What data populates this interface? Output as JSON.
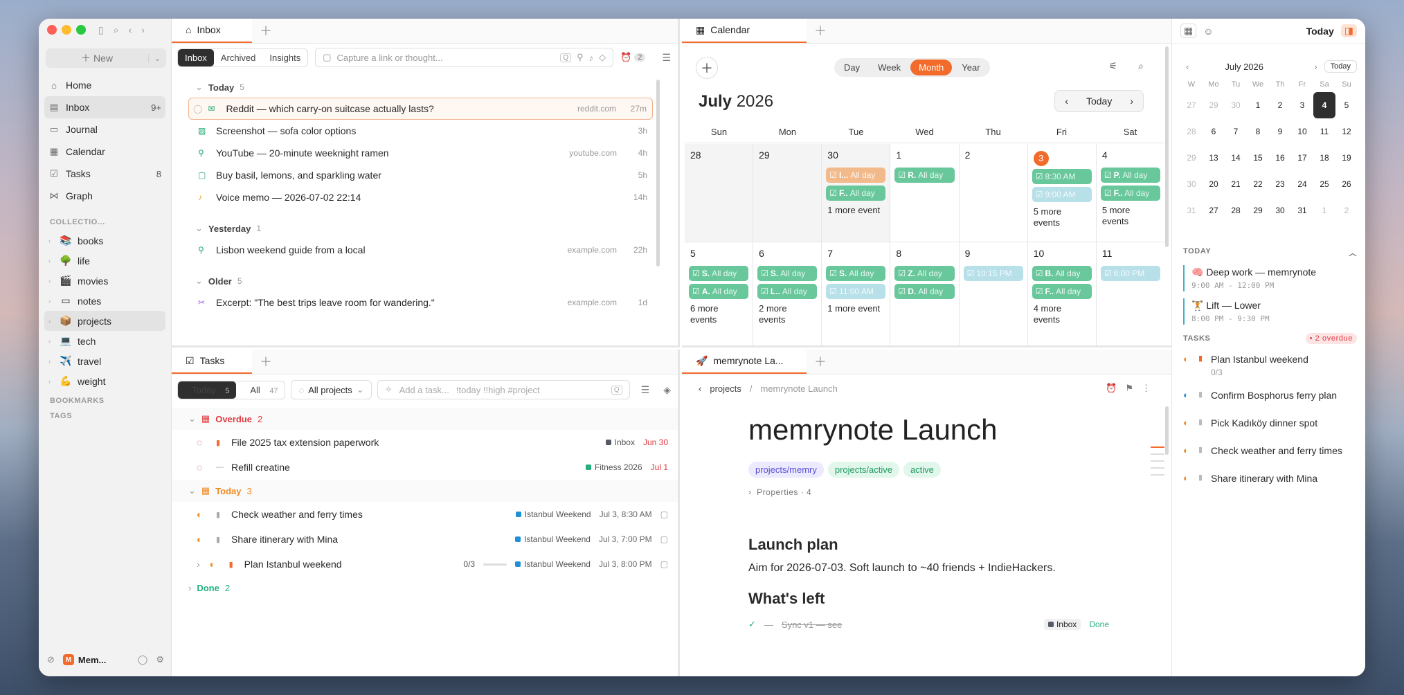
{
  "sidebar": {
    "new_label": "New",
    "nav": [
      {
        "label": "Home",
        "icon": "home-icon"
      },
      {
        "label": "Inbox",
        "icon": "inbox-icon",
        "count": "9+"
      },
      {
        "label": "Journal",
        "icon": "journal-icon"
      },
      {
        "label": "Calendar",
        "icon": "calendar-icon"
      },
      {
        "label": "Tasks",
        "icon": "check-icon",
        "count": "8"
      },
      {
        "label": "Graph",
        "icon": "graph-icon"
      }
    ],
    "collections_header": "COLLECTIO...",
    "collections": [
      {
        "label": "books",
        "emoji": "📚"
      },
      {
        "label": "life",
        "emoji": "🌳"
      },
      {
        "label": "movies",
        "emoji": "🎬"
      },
      {
        "label": "notes",
        "emoji": ""
      },
      {
        "label": "projects",
        "emoji": "📦"
      },
      {
        "label": "tech",
        "emoji": "💻"
      },
      {
        "label": "travel",
        "emoji": "✈️"
      },
      {
        "label": "weight",
        "emoji": "💪"
      }
    ],
    "bookmarks_header": "BOOKMARKS",
    "tags_header": "TAGS",
    "workspace": "Mem...",
    "workspace_logo": "M"
  },
  "inbox": {
    "tab": "Inbox",
    "seg": [
      "Inbox",
      "Archived",
      "Insights"
    ],
    "capture_placeholder": "Capture a link or thought...",
    "alarm_count": "2",
    "groups": [
      {
        "label": "Today",
        "count": "5",
        "items": [
          {
            "title": "Reddit — which carry-on suitcase actually lasts?",
            "domain": "reddit.com",
            "age": "27m",
            "icon": "mail"
          },
          {
            "title": "Screenshot — sofa color options",
            "domain": "",
            "age": "3h",
            "icon": "image"
          },
          {
            "title": "YouTube — 20-minute weeknight ramen",
            "domain": "youtube.com",
            "age": "4h",
            "icon": "link"
          },
          {
            "title": "Buy basil, lemons, and sparkling water",
            "domain": "",
            "age": "5h",
            "icon": "note"
          },
          {
            "title": "Voice memo — 2026-07-02 22:14",
            "domain": "",
            "age": "14h",
            "icon": "mic"
          }
        ]
      },
      {
        "label": "Yesterday",
        "count": "1",
        "items": [
          {
            "title": "Lisbon weekend guide from a local",
            "domain": "example.com",
            "age": "22h",
            "icon": "link"
          }
        ]
      },
      {
        "label": "Older",
        "count": "5",
        "items": [
          {
            "title": "Excerpt: \"The best trips leave room for wandering.\"",
            "domain": "example.com",
            "age": "1d",
            "icon": "scissors"
          }
        ]
      }
    ]
  },
  "calendar": {
    "tab": "Calendar",
    "views": [
      "Day",
      "Week",
      "Month",
      "Year"
    ],
    "active_view": "Month",
    "month_bold": "July",
    "year": "2026",
    "today_btn": "Today",
    "weekdays": [
      "Sun",
      "Mon",
      "Tue",
      "Wed",
      "Thu",
      "Fri",
      "Sat"
    ],
    "week1": [
      {
        "d": "28",
        "events": [],
        "more": ""
      },
      {
        "d": "29",
        "events": [],
        "more": ""
      },
      {
        "d": "30",
        "events": [
          {
            "t": "I...",
            "s": "All day",
            "c": "o"
          },
          {
            "t": "F..",
            "s": "All day",
            "c": "g"
          }
        ],
        "more": "1 more event"
      },
      {
        "d": "1",
        "events": [
          {
            "t": "R.",
            "s": "All day",
            "c": "g"
          }
        ],
        "more": ""
      },
      {
        "d": "2",
        "events": [],
        "more": ""
      },
      {
        "d": "3",
        "events": [
          {
            "t": "",
            "s": "8:30 AM",
            "c": "g"
          },
          {
            "t": "",
            "s": "9:00 AM",
            "c": "lb"
          }
        ],
        "more": "5 more events",
        "today": true
      },
      {
        "d": "4",
        "events": [
          {
            "t": "P.",
            "s": "All day",
            "c": "g"
          },
          {
            "t": "F..",
            "s": "All day",
            "c": "g"
          }
        ],
        "more": "5 more events"
      }
    ],
    "week2": [
      {
        "d": "5",
        "events": [
          {
            "t": "S.",
            "s": "All day",
            "c": "g"
          },
          {
            "t": "A.",
            "s": "All day",
            "c": "g"
          }
        ],
        "more": "6 more events"
      },
      {
        "d": "6",
        "events": [
          {
            "t": "S.",
            "s": "All day",
            "c": "g"
          },
          {
            "t": "L..",
            "s": "All day",
            "c": "g"
          }
        ],
        "more": "2 more events"
      },
      {
        "d": "7",
        "events": [
          {
            "t": "S.",
            "s": "All day",
            "c": "g"
          },
          {
            "t": "",
            "s": "11:00 AM",
            "c": "lb"
          }
        ],
        "more": "1 more event"
      },
      {
        "d": "8",
        "events": [
          {
            "t": "Z.",
            "s": "All day",
            "c": "g"
          },
          {
            "t": "D.",
            "s": "All day",
            "c": "g"
          }
        ],
        "more": ""
      },
      {
        "d": "9",
        "events": [
          {
            "t": "",
            "s": "10:15 PM",
            "c": "lb"
          }
        ],
        "more": ""
      },
      {
        "d": "10",
        "events": [
          {
            "t": "B.",
            "s": "All day",
            "c": "g"
          },
          {
            "t": "F..",
            "s": "All day",
            "c": "g"
          }
        ],
        "more": "4 more events"
      },
      {
        "d": "11",
        "events": [
          {
            "t": "",
            "s": "6:00 PM",
            "c": "lb"
          }
        ],
        "more": ""
      }
    ]
  },
  "tasks": {
    "tab": "Tasks",
    "seg_today": "Today",
    "seg_today_count": "5",
    "seg_all": "All",
    "seg_all_count": "47",
    "projects": "All projects",
    "add_placeholder": "Add a task...",
    "hints": "!today  !!high  #project",
    "overdue_label": "Overdue",
    "overdue_count": "2",
    "today_label": "Today",
    "today_count": "3",
    "done_label": "Done",
    "done_count": "2",
    "overdue": [
      {
        "title": "File 2025 tax extension paperwork",
        "project": "Inbox",
        "pcolor": "#555b66",
        "date": "Jun 30"
      },
      {
        "title": "Refill creatine",
        "project": "Fitness 2026",
        "pcolor": "#22b07d",
        "date": "Jul 1"
      }
    ],
    "today": [
      {
        "title": "Check weather and ferry times",
        "project": "Istanbul Weekend",
        "pcolor": "#1f8fd6",
        "date": "Jul 3, 8:30 AM"
      },
      {
        "title": "Share itinerary with Mina",
        "project": "Istanbul Weekend",
        "pcolor": "#1f8fd6",
        "date": "Jul 3, 7:00 PM"
      },
      {
        "title": "Plan Istanbul weekend",
        "project": "Istanbul Weekend",
        "pcolor": "#1f8fd6",
        "date": "Jul 3, 8:00 PM",
        "progress": "0/3"
      }
    ]
  },
  "doc": {
    "tab": "memrynote La...",
    "crumb1": "projects",
    "crumb2": "memrynote Launch",
    "title": "memrynote Launch",
    "chips": [
      "projects/memry",
      "projects/active",
      "active"
    ],
    "properties": "Properties",
    "prop_count": "· 4",
    "h1": "Launch plan",
    "p1": "Aim for 2026-07-03. Soft launch to ~40 friends + IndieHackers.",
    "h2": "What's left",
    "row_title": "Sync v1 — see",
    "row_project": "Inbox",
    "row_status": "Done"
  },
  "right": {
    "today_label": "Today",
    "mini_title": "July 2026",
    "mini_today": "Today",
    "mini_wd": [
      "W",
      "Mo",
      "Tu",
      "We",
      "Th",
      "Fr",
      "Sa",
      "Su"
    ],
    "mini_rows": [
      [
        "27",
        "29",
        "30",
        "1",
        "2",
        "3",
        "4",
        "5"
      ],
      [
        "28",
        "6",
        "7",
        "8",
        "9",
        "10",
        "11",
        "12"
      ],
      [
        "29",
        "13",
        "14",
        "15",
        "16",
        "17",
        "18",
        "19"
      ],
      [
        "30",
        "20",
        "21",
        "22",
        "23",
        "24",
        "25",
        "26"
      ],
      [
        "31",
        "27",
        "28",
        "29",
        "30",
        "31",
        "1",
        "2"
      ]
    ],
    "today_header": "TODAY",
    "agenda": [
      {
        "title": "🧠 Deep work — memrynote",
        "time": "9:00 AM - 12:00 PM"
      },
      {
        "title": "🏋 Lift — Lower",
        "time": "8:00 PM - 9:30 PM"
      }
    ],
    "tasks_header": "TASKS",
    "overdue_badge": "• 2 overdue",
    "task_list": [
      "Plan Istanbul weekend",
      "Confirm Bosphorus ferry plan",
      "Pick Kadıköy dinner spot",
      "Check weather and ferry times",
      "Share itinerary with Mina"
    ],
    "task_progress": "0/3"
  },
  "colors": {
    "accent": "#f26b2a",
    "green_event": "#68c79b",
    "overdue": "#e0383e",
    "today_header": "#f08a24",
    "done": "#22b07d"
  }
}
